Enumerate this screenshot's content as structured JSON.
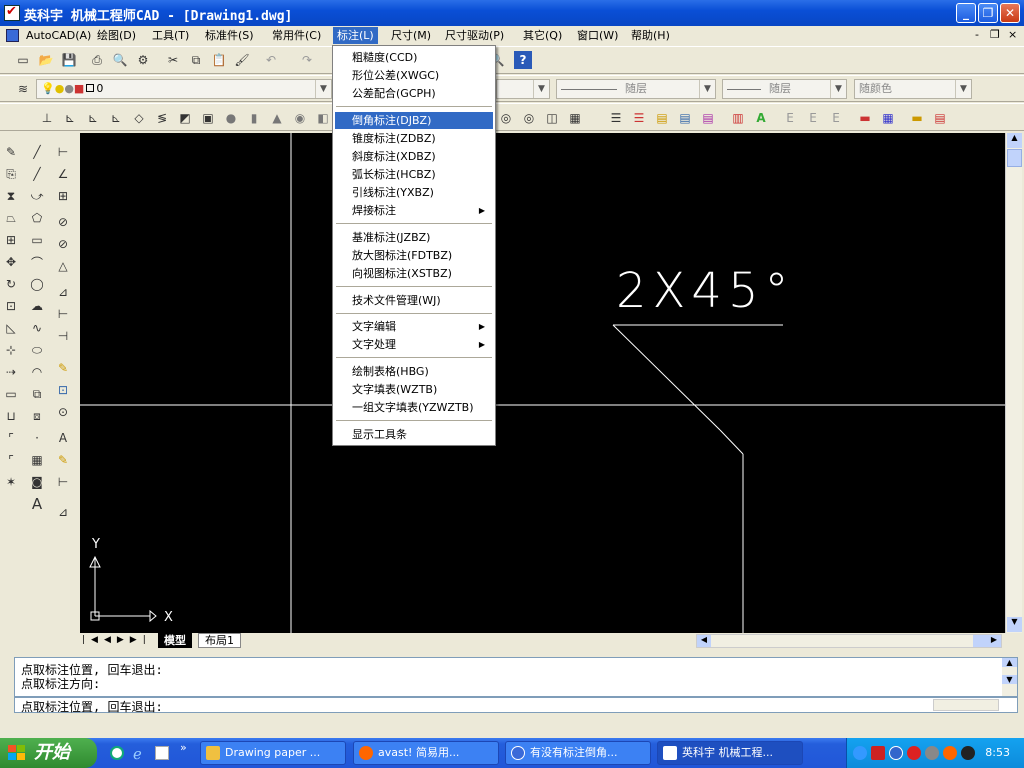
{
  "window": {
    "title": "英科宇 机械工程师CAD - [Drawing1.dwg]",
    "controls": {
      "minimize": "_",
      "restore": "❐",
      "close": "✕"
    }
  },
  "menubar": {
    "items": [
      {
        "label": "AutoCAD(A)"
      },
      {
        "label": "绘图(D)"
      },
      {
        "label": "工具(T)"
      },
      {
        "label": "标准件(S)"
      },
      {
        "label": "常用件(C)"
      },
      {
        "label": "标注(L)"
      },
      {
        "label": "尺寸(M)"
      },
      {
        "label": "尺寸驱动(P)"
      },
      {
        "label": "其它(Q)"
      },
      {
        "label": "窗口(W)"
      },
      {
        "label": "帮助(H)"
      }
    ],
    "mdi": {
      "minimize": "-",
      "restore": "❐",
      "close": "×"
    }
  },
  "toolbar": {
    "layer": {
      "value": "0"
    },
    "linetype": {
      "value": "随层"
    },
    "lineweight": {
      "value": "随层"
    },
    "color": {
      "value": "随颜色"
    }
  },
  "dropdown": {
    "items": [
      {
        "label": "粗糙度(CCD)"
      },
      {
        "label": "形位公差(XWGC)"
      },
      {
        "label": "公差配合(GCPH)"
      },
      {
        "label": "倒角标注(DJBZ)"
      },
      {
        "label": "锥度标注(ZDBZ)"
      },
      {
        "label": "斜度标注(XDBZ)"
      },
      {
        "label": "弧长标注(HCBZ)"
      },
      {
        "label": "引线标注(YXBZ)"
      },
      {
        "label": "焊接标注"
      },
      {
        "label": "基准标注(JZBZ)"
      },
      {
        "label": "放大图标注(FDTBZ)"
      },
      {
        "label": "向视图标注(XSTBZ)"
      },
      {
        "label": "技术文件管理(WJ)"
      },
      {
        "label": "文字编辑"
      },
      {
        "label": "文字处理"
      },
      {
        "label": "绘制表格(HBG)"
      },
      {
        "label": "文字填表(WZTB)"
      },
      {
        "label": "一组文字填表(YZWZTB)"
      },
      {
        "label": "显示工具条"
      }
    ],
    "highlighted": "倒角标注(DJBZ)"
  },
  "drawing": {
    "annotation": "2X45°",
    "ucs": {
      "x": "X",
      "y": "Y"
    }
  },
  "tabs": {
    "model": "模型",
    "layout1": "布局1"
  },
  "command": {
    "history": [
      "点取标注位置, 回车退出:",
      "点取标注方向:"
    ],
    "current": "点取标注位置, 回车退出:"
  },
  "taskbar": {
    "start": "开始",
    "buttons": [
      {
        "label": "Drawing paper ..."
      },
      {
        "label": "avast! 简易用..."
      },
      {
        "label": "有没有标注倒角..."
      },
      {
        "label": "英科宇 机械工程..."
      }
    ],
    "clock": "8:53"
  },
  "colors": {
    "accent": "#316ac5",
    "titlebar": "#0a4fd6",
    "canvas": "#000000"
  }
}
